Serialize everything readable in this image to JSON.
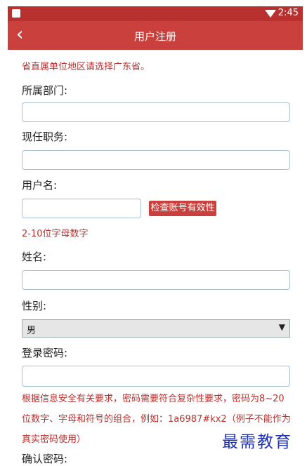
{
  "status": {
    "time": "2:45"
  },
  "nav": {
    "back": "‹",
    "title": "用户注册"
  },
  "notice": "省直属单位地区请选择广东省。",
  "form": {
    "department_label": "所属部门:",
    "position_label": "现任职务:",
    "username_label": "用户名:",
    "check_button": "检查账号有效性",
    "username_hint": "2-10位字母数字",
    "name_label": "姓名:",
    "gender_label": "性别:",
    "gender_value": "男",
    "password_label": "登录密码:",
    "password_hint": "根据信息安全有关要求，密码需要符合复杂性要求，密码为8~20位数字、字母和符号的组合，例如：1a6987#kx2（例子不能作为真实密码使用）",
    "confirm_label": "确认密码:"
  },
  "watermark": "最需教育"
}
